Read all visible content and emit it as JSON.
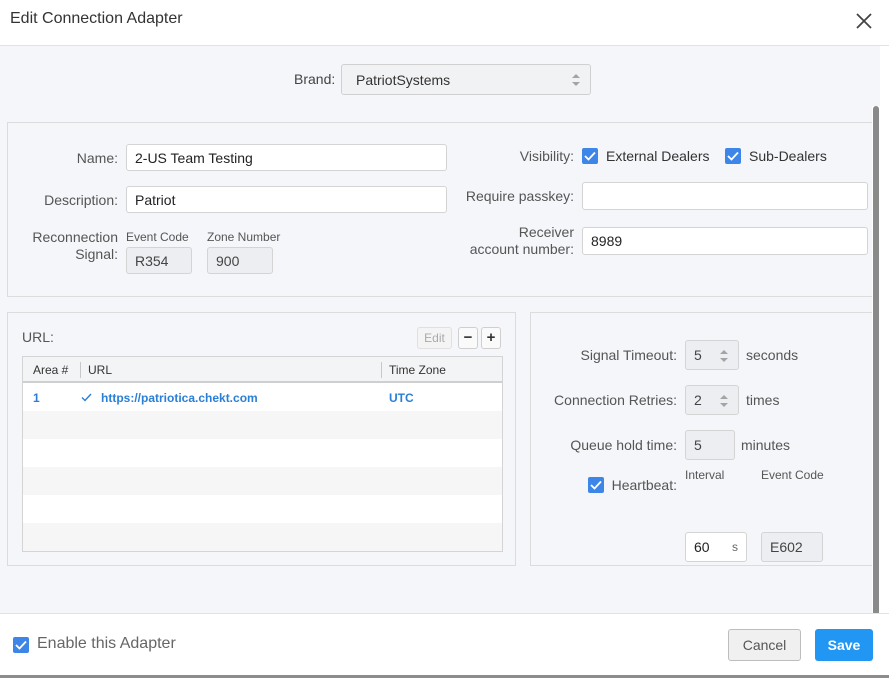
{
  "dialog": {
    "title": "Edit Connection Adapter"
  },
  "brand": {
    "label": "Brand:",
    "value": "PatriotSystems"
  },
  "general": {
    "name_label": "Name:",
    "name_value": "2-US Team Testing",
    "description_label": "Description:",
    "description_value": "Patriot",
    "reconnection_label_1": "Reconnection",
    "reconnection_label_2": "Signal:",
    "event_code_label": "Event Code",
    "event_code_value": "R354",
    "zone_number_label": "Zone Number",
    "zone_number_value": "900",
    "visibility_label": "Visibility:",
    "external_dealers_label": "External Dealers",
    "external_dealers_checked": true,
    "sub_dealers_label": "Sub-Dealers",
    "sub_dealers_checked": true,
    "passkey_label": "Require passkey:",
    "passkey_value": "",
    "receiver_label_1": "Receiver",
    "receiver_label_2": "account number:",
    "receiver_value": "8989"
  },
  "url_panel": {
    "label": "URL:",
    "edit_label": "Edit",
    "remove_label": "−",
    "add_label": "+",
    "columns": [
      "Area #",
      "URL",
      "Time Zone"
    ],
    "rows": [
      {
        "area": "1",
        "url": "https://patriotica.chekt.com",
        "time_zone": "UTC"
      }
    ]
  },
  "signal": {
    "timeout_label": "Signal Timeout:",
    "timeout_value": "5",
    "timeout_unit": "seconds",
    "retries_label": "Connection Retries:",
    "retries_value": "2",
    "retries_unit": "times",
    "queue_label": "Queue hold time:",
    "queue_value": "5",
    "queue_unit": "minutes",
    "heartbeat_label": "Heartbeat:",
    "heartbeat_checked": true,
    "interval_label": "Interval",
    "interval_value": "60",
    "interval_unit": "s",
    "hb_event_code_label": "Event Code",
    "hb_event_code_value": "E602"
  },
  "footer": {
    "enable_label": "Enable this Adapter",
    "enable_checked": true,
    "cancel_label": "Cancel",
    "save_label": "Save"
  },
  "colors": {
    "accent": "#2196f3",
    "checkbox": "#3d86e8",
    "link": "#2a7fd6"
  },
  "icons": {
    "close": "close-icon",
    "check": "check-icon",
    "spinner": "updown-arrows-icon"
  }
}
